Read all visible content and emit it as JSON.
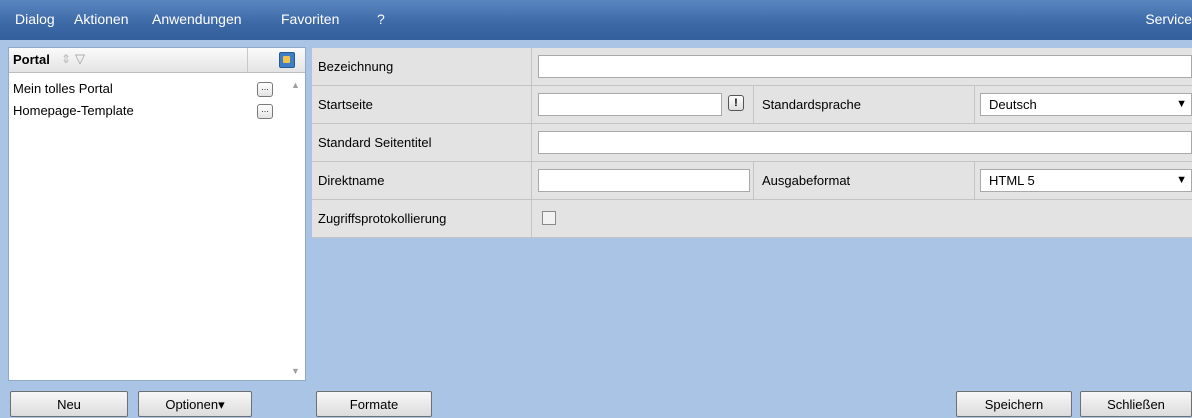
{
  "menu": {
    "items": [
      {
        "label": "Dialog"
      },
      {
        "label": "Aktionen"
      },
      {
        "label": "Anwendungen"
      },
      {
        "label": "Favoriten"
      },
      {
        "label": "?"
      }
    ],
    "right_label": "Service"
  },
  "left_panel": {
    "title": "Portal",
    "items": [
      {
        "label": "Mein tolles Portal",
        "button": "..."
      },
      {
        "label": "Homepage-Template",
        "button": "..."
      }
    ],
    "new_button": "Neu",
    "options_button": "Optionen▾"
  },
  "form": {
    "bezeichnung": {
      "label": "Bezeichnung",
      "value": ""
    },
    "startseite": {
      "label": "Startseite",
      "value": "",
      "warn": "!"
    },
    "standardsprache": {
      "label": "Standardsprache",
      "value": "Deutsch"
    },
    "standard_seitentitel": {
      "label": "Standard Seitentitel",
      "value": ""
    },
    "direktname": {
      "label": "Direktname",
      "value": ""
    },
    "ausgabeformat": {
      "label": "Ausgabeformat",
      "value": "HTML 5"
    },
    "zugriffsprotokollierung": {
      "label": "Zugriffsprotokollierung",
      "checked": false
    }
  },
  "footer": {
    "formate_button": "Formate",
    "save_button": "Speichern",
    "close_button": "Schließen"
  },
  "colors": {
    "menubar": "#3e6aa8",
    "background": "#a9c4e4",
    "row_bg": "#e3e3e3"
  }
}
